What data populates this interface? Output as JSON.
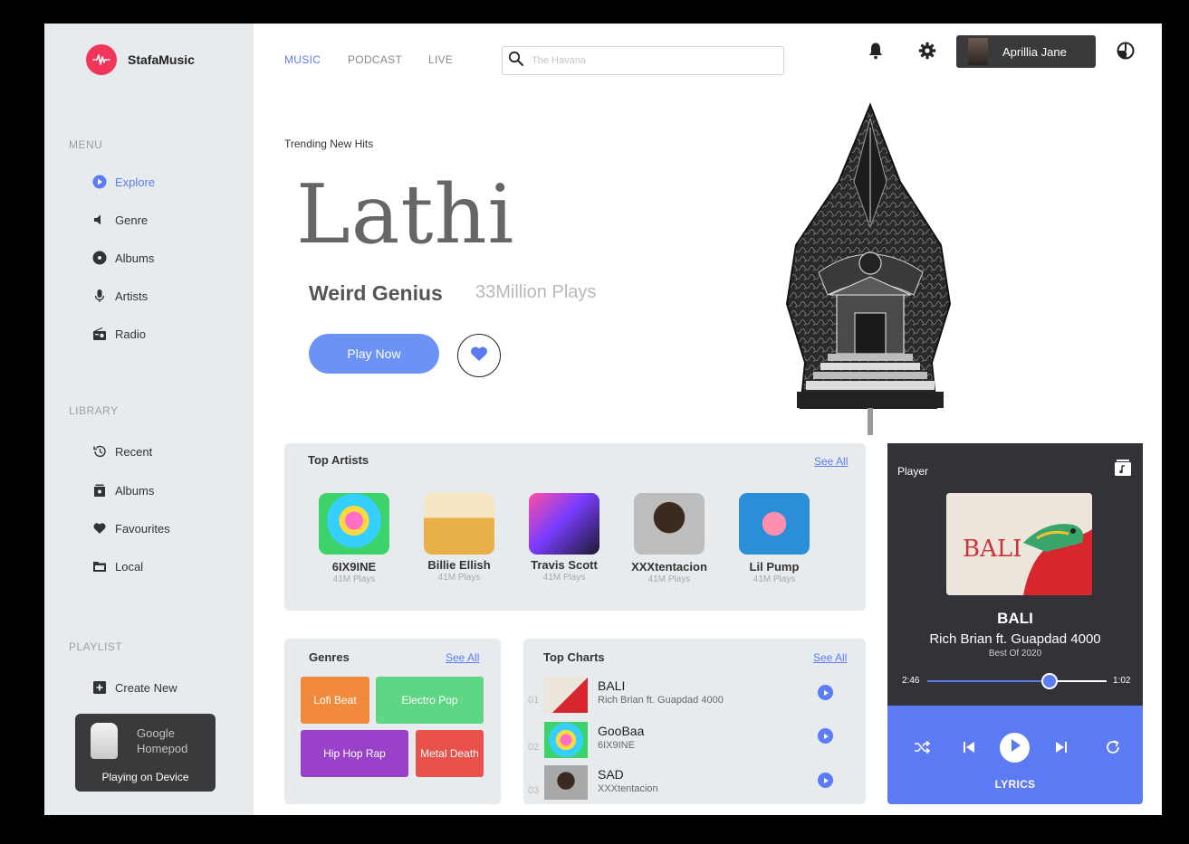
{
  "brand": {
    "name": "StafaMusic"
  },
  "sidebar": {
    "menu_title": "MENU",
    "menu": [
      {
        "label": "Explore",
        "icon": "play-circle-icon",
        "active": true
      },
      {
        "label": "Genre",
        "icon": "speaker-icon"
      },
      {
        "label": "Albums",
        "icon": "disc-icon"
      },
      {
        "label": "Artists",
        "icon": "microphone-icon"
      },
      {
        "label": "Radio",
        "icon": "radio-icon"
      }
    ],
    "library_title": "LIBRARY",
    "library": [
      {
        "label": "Recent",
        "icon": "history-icon"
      },
      {
        "label": "Albums",
        "icon": "album-stack-icon"
      },
      {
        "label": "Favourites",
        "icon": "heart-icon"
      },
      {
        "label": "Local",
        "icon": "folder-icon"
      }
    ],
    "playlist_title": "PLAYLIST",
    "create_new": "Create New",
    "device": {
      "name": "Google Homepod",
      "status": "Playing on Device"
    }
  },
  "topbar": {
    "tabs": [
      {
        "label": "MUSIC",
        "active": true
      },
      {
        "label": "PODCAST"
      },
      {
        "label": "LIVE"
      }
    ],
    "search_placeholder": "The Havana",
    "user_name": "Aprillia Jane"
  },
  "hero": {
    "label": "Trending New Hits",
    "title": "Lathi",
    "artist": "Weird Genius",
    "plays": "33Million Plays",
    "play_button": "Play Now"
  },
  "top_artists": {
    "title": "Top Artists",
    "see_all": "See All",
    "items": [
      {
        "name": "6IX9INE",
        "plays": "41M Plays"
      },
      {
        "name": "Billie Ellish",
        "plays": "41M Plays"
      },
      {
        "name": "Travis Scott",
        "plays": "41M Plays"
      },
      {
        "name": "XXXtentacion",
        "plays": "41M Plays"
      },
      {
        "name": "Lil Pump",
        "plays": "41M Plays"
      }
    ]
  },
  "genres": {
    "title": "Genres",
    "see_all": "See All",
    "items": [
      {
        "label": "Lofi Beat",
        "color": "#f28a3d"
      },
      {
        "label": "Electro Pop",
        "color": "#5fd684"
      },
      {
        "label": "Hip Hop Rap",
        "color": "#9a41c9"
      },
      {
        "label": "Metal Death",
        "color": "#e8524a"
      }
    ]
  },
  "top_charts": {
    "title": "Top Charts",
    "see_all": "See All",
    "items": [
      {
        "rank": "01",
        "title": "BALI",
        "artist": "Rich Brian ft. Guapdad 4000"
      },
      {
        "rank": "02",
        "title": "GooBaa",
        "artist": "6IX9INE"
      },
      {
        "rank": "03",
        "title": "SAD",
        "artist": "XXXtentacion"
      }
    ]
  },
  "player": {
    "label": "Player",
    "song": "BALI",
    "artist": "Rich Brian ft. Guapdad 4000",
    "album": "Best Of 2020",
    "elapsed": "2:46",
    "remaining": "1:02",
    "progress": 0.68,
    "lyrics": "LYRICS"
  },
  "colors": {
    "accent": "#5b7cf5",
    "brand": "#f2355a",
    "dark": "#323238"
  }
}
